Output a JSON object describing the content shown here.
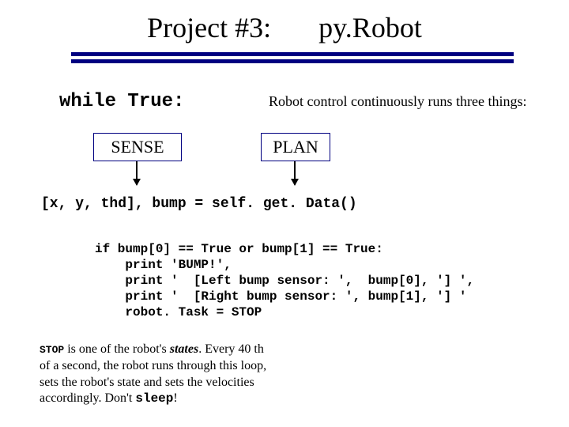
{
  "title": {
    "left": "Project #3:",
    "right": "py.Robot"
  },
  "while_true": "while True:",
  "subtitle": "Robot control continuously runs three things:",
  "boxes": {
    "sense": "SENSE",
    "plan": "PLAN"
  },
  "code_line1": "[x, y, thd], bump = self. get. Data()",
  "code_block": "if bump[0] == True or bump[1] == True:\n    print 'BUMP!',\n    print '  [Left bump sensor: ',  bump[0], '] ',\n    print '  [Right bump sensor: ', bump[1], '] '\n    robot. Task = STOP",
  "footnote": {
    "p1a": " is one of the robot's ",
    "states": "states",
    "p1b": ". Every 40 th of a second, the robot runs through this loop, sets the robot's state and sets the velocities accordingly. Don't ",
    "sleep": "sleep",
    "p1c": "!"
  },
  "stop": "STOP"
}
